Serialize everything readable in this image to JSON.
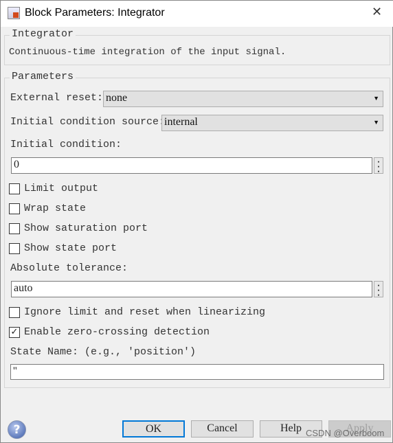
{
  "window": {
    "title": "Block Parameters: Integrator",
    "close_icon": "close-icon"
  },
  "description": {
    "legend": "Integrator",
    "text": "Continuous-time integration of the input signal."
  },
  "parameters": {
    "legend": "Parameters",
    "external_reset": {
      "label": "External reset:",
      "value": "none"
    },
    "ic_source": {
      "label": "Initial condition source:",
      "value": "internal"
    },
    "initial_condition": {
      "label": "Initial condition:",
      "value": "0"
    },
    "checkboxes": [
      {
        "label": "Limit output",
        "checked": false
      },
      {
        "label": "Wrap state",
        "checked": false
      },
      {
        "label": "Show saturation port",
        "checked": false
      },
      {
        "label": "Show state port",
        "checked": false
      }
    ],
    "absolute_tolerance": {
      "label": "Absolute tolerance:",
      "value": "auto"
    },
    "checkboxes2": [
      {
        "label": "Ignore limit and reset when linearizing",
        "checked": false
      },
      {
        "label": "Enable zero-crossing detection",
        "checked": true
      }
    ],
    "state_name": {
      "label": "State Name: (e.g., 'position')",
      "value": "''"
    }
  },
  "buttons": {
    "ok": "OK",
    "cancel": "Cancel",
    "help": "Help",
    "apply": "Apply"
  },
  "watermark": "CSDN @Overboom"
}
